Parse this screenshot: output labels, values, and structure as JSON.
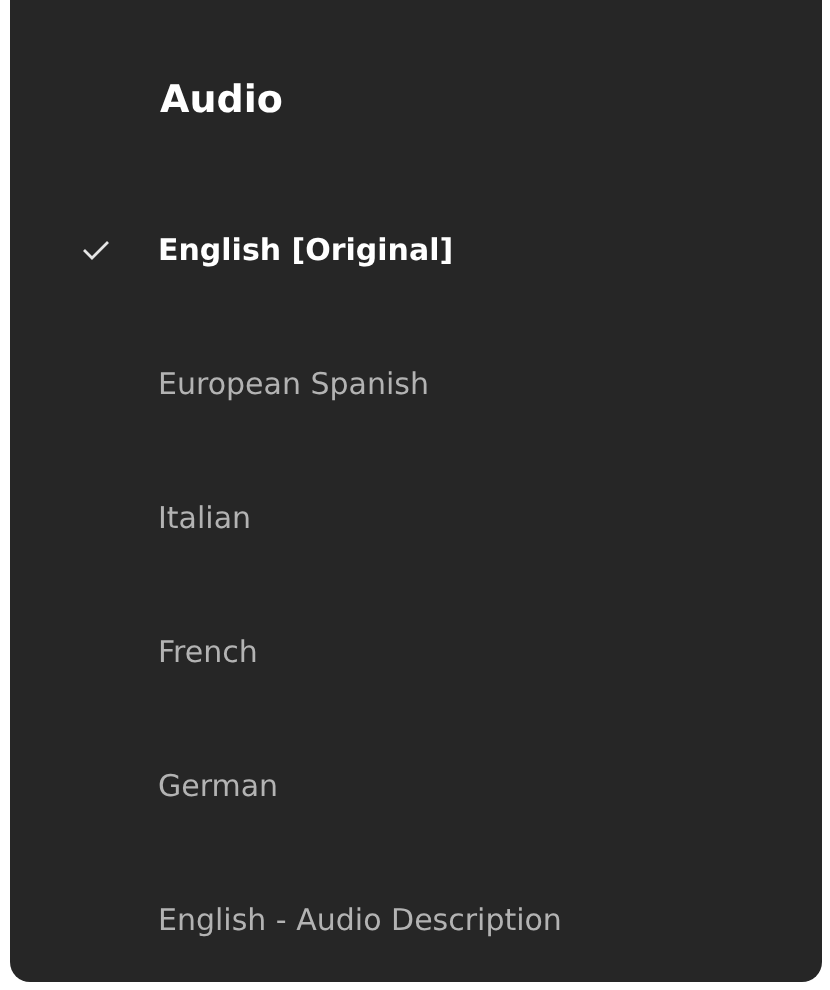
{
  "title": "Audio",
  "options": [
    {
      "label": "English [Original]",
      "selected": true
    },
    {
      "label": "European Spanish",
      "selected": false
    },
    {
      "label": "Italian",
      "selected": false
    },
    {
      "label": "French",
      "selected": false
    },
    {
      "label": "German",
      "selected": false
    },
    {
      "label": "English - Audio Description",
      "selected": false
    }
  ]
}
